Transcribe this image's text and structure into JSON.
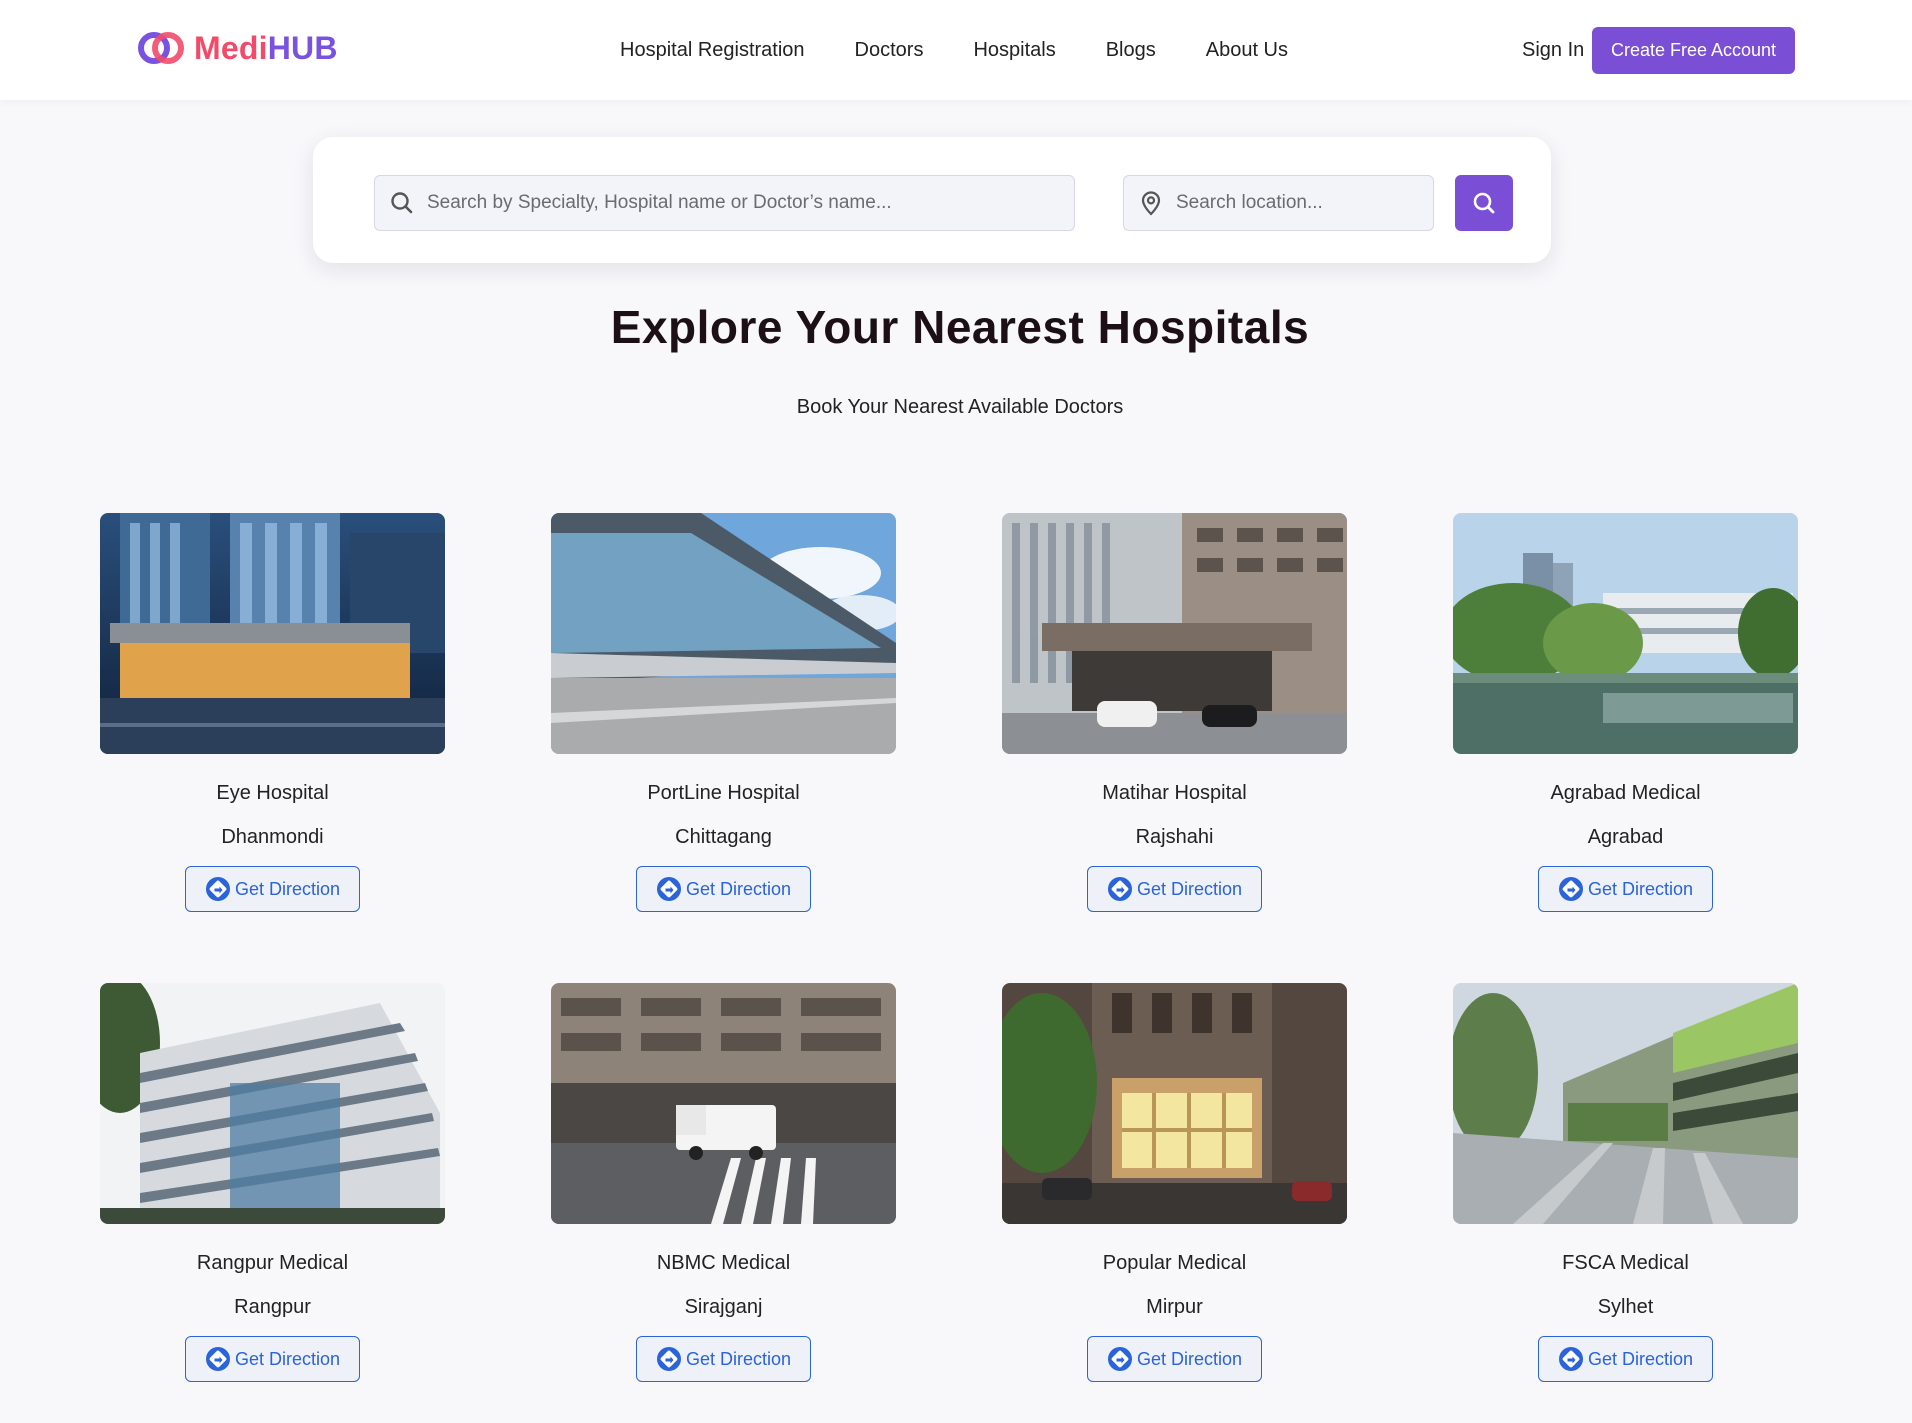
{
  "header": {
    "logo_text_part1": "Medi",
    "logo_text_part2": "HUB",
    "nav": [
      {
        "label": "Hospital Registration"
      },
      {
        "label": "Doctors"
      },
      {
        "label": "Hospitals"
      },
      {
        "label": "Blogs"
      },
      {
        "label": "About Us"
      }
    ],
    "sign_in": "Sign In",
    "create_account": "Create Free Account"
  },
  "search": {
    "main_placeholder": "Search by Specialty, Hospital name or Doctor’s name...",
    "main_value": "",
    "location_placeholder": "Search location...",
    "location_value": ""
  },
  "section": {
    "title": "Explore Your Nearest Hospitals",
    "subtitle": "Book Your Nearest Available Doctors"
  },
  "hospitals": [
    {
      "name": "Eye Hospital",
      "city": "Dhanmondi",
      "button": "Get Direction"
    },
    {
      "name": "PortLine Hospital",
      "city": "Chittagang",
      "button": "Get Direction"
    },
    {
      "name": "Matihar Hospital",
      "city": "Rajshahi",
      "button": "Get Direction"
    },
    {
      "name": "Agrabad Medical",
      "city": "Agrabad",
      "button": "Get Direction"
    },
    {
      "name": "Rangpur Medical",
      "city": "Rangpur",
      "button": "Get Direction"
    },
    {
      "name": "NBMC Medical",
      "city": "Sirajganj",
      "button": "Get Direction"
    },
    {
      "name": "Popular Medical",
      "city": "Mirpur",
      "button": "Get Direction"
    },
    {
      "name": "FSCA Medical",
      "city": "Sylhet",
      "button": "Get Direction"
    }
  ],
  "colors": {
    "accent": "#7a4fd6",
    "logo_red": "#f24b6a",
    "logo_purple": "#7a52e0",
    "direction_blue": "#2b63d9"
  }
}
